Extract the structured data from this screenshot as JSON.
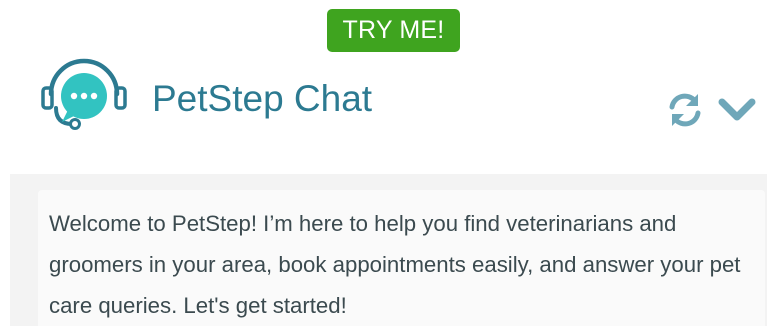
{
  "badge": {
    "label": "TRY ME!"
  },
  "header": {
    "title": "PetStep Chat",
    "logo_icon": "headset-chat-bubble-icon",
    "actions": {
      "refresh_icon": "refresh-icon",
      "collapse_icon": "chevron-down-icon"
    }
  },
  "messages": [
    {
      "sender": "bot",
      "text": "Welcome to PetStep! I’m here to help you find veterinarians and groomers in your area, book appointments easily, and answer your pet care queries. Let's get started!"
    }
  ],
  "colors": {
    "badge_bg": "#3fa41f",
    "brand_teal": "#2c7a91",
    "logo_bubble": "#32c3c1",
    "icon_light": "#6fa7b9",
    "chat_bg": "#f3f3f3",
    "bubble_bg": "#fafafa",
    "text": "#3b4a4f"
  }
}
